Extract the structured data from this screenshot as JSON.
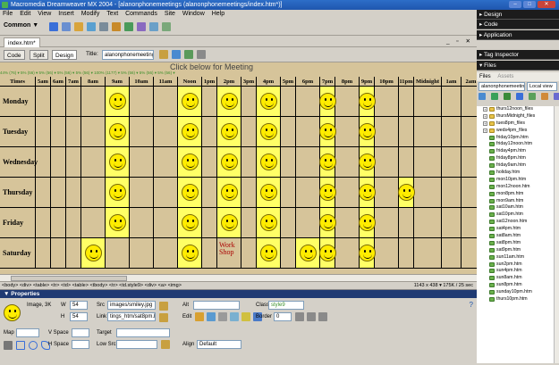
{
  "window": {
    "title": "Macromedia Dreamweaver MX 2004 - [alanonphonemeetings (alanonphonemeetings/index.htm*)]"
  },
  "menu": [
    "File",
    "Edit",
    "View",
    "Insert",
    "Modify",
    "Text",
    "Commands",
    "Site",
    "Window",
    "Help"
  ],
  "insert_bar": {
    "category": "Common ▼"
  },
  "document": {
    "tab": "index.htm*",
    "view_buttons": [
      "Code",
      "Split",
      "Design"
    ],
    "title_label": "Title:",
    "title_value": "alanonphonemeetings",
    "page_heading": "Click       below for Meeting",
    "ruler_text": "44% (76) ▾ 5% (56) ▾ 5% (56) ▾ 5% (56) ▾ 5% (56) ▾ 100% (1177) ▾ 5% (56) ▾ 5% (56) ▾ 5% (56) ▾",
    "columns": [
      "Times",
      "5am",
      "6am",
      "7am",
      "8am",
      "9am",
      "10am",
      "11am",
      "Noon",
      "1pm",
      "2pm",
      "3pm",
      "4pm",
      "5pm",
      "6pm",
      "7pm",
      "8pm",
      "9pm",
      "10pm",
      "11pm",
      "Midnight",
      "1am",
      "2am"
    ],
    "days": [
      {
        "name": "Monday",
        "slots": [
          5,
          8,
          10,
          12,
          15,
          17
        ]
      },
      {
        "name": "Tuesday",
        "slots": [
          5,
          8,
          10,
          12,
          15,
          17
        ]
      },
      {
        "name": "Wednesday",
        "slots": [
          5,
          8,
          10,
          12,
          15,
          17
        ]
      },
      {
        "name": "Thursday",
        "slots": [
          5,
          8,
          10,
          12,
          15,
          17,
          19
        ]
      },
      {
        "name": "Friday",
        "slots": [
          5,
          8,
          10,
          12,
          15,
          17
        ]
      },
      {
        "name": "Saturday",
        "slots": [
          4,
          8,
          12,
          14,
          15,
          17
        ]
      }
    ],
    "workshop_label": "Work Shop",
    "status_path": "<body> <div> <table> <tr> <td> <table> <tbody> <tr> <td.style9> <div> <a> <img>",
    "status_right": "1143 x 438 ▾ 175K / 25 sec"
  },
  "properties": {
    "header": "▼ Properties",
    "image_label": "Image, 3K",
    "w_label": "W",
    "w_value": "54",
    "h_label": "H",
    "h_value": "54",
    "src_label": "Src",
    "src_value": "images/smiley.jpg",
    "link_label": "Link",
    "link_value": "tings_htm/sat8pm.htm",
    "alt_label": "Alt",
    "class_label": "Class",
    "class_value": "style9",
    "edit_label": "Edit",
    "border_label": "Border",
    "border_value": "0",
    "align_label": "Align",
    "align_value": "Default",
    "map_label": "Map",
    "vspace_label": "V Space",
    "hspace_label": "H Space",
    "target_label": "Target",
    "lowsrc_label": "Low Src"
  },
  "panels": {
    "groups": [
      "▸ Design",
      "▸ Code",
      "▸ Application",
      "▸ Tag Inspector",
      "▾ Files"
    ],
    "files_tabs": [
      "Files",
      "Assets"
    ],
    "site": "alanonphonemeetings",
    "view": "Local view",
    "items": [
      {
        "type": "folder",
        "name": "thurs12noon_files"
      },
      {
        "type": "folder",
        "name": "thursMidnight_files"
      },
      {
        "type": "folder",
        "name": "tues8pm_files"
      },
      {
        "type": "folder",
        "name": "weds4pm_files"
      },
      {
        "type": "file",
        "name": "friday10pm.htm"
      },
      {
        "type": "file",
        "name": "friday12noon.htm"
      },
      {
        "type": "file",
        "name": "friday4pm.htm"
      },
      {
        "type": "file",
        "name": "friday8pm.htm"
      },
      {
        "type": "file",
        "name": "friday9am.htm"
      },
      {
        "type": "file",
        "name": "holiday.htm"
      },
      {
        "type": "file",
        "name": "mon10pm.htm"
      },
      {
        "type": "file",
        "name": "mon12noon.htm"
      },
      {
        "type": "file",
        "name": "mon8pm.htm"
      },
      {
        "type": "file",
        "name": "mon9am.htm"
      },
      {
        "type": "file",
        "name": "sat10am.htm"
      },
      {
        "type": "file",
        "name": "sat10pm.htm"
      },
      {
        "type": "file",
        "name": "sat12noon.htm"
      },
      {
        "type": "file",
        "name": "sat4pm.htm"
      },
      {
        "type": "file",
        "name": "sat8am.htm"
      },
      {
        "type": "file",
        "name": "sat8pm.htm"
      },
      {
        "type": "file",
        "name": "sat9pm.htm"
      },
      {
        "type": "file",
        "name": "sun11am.htm"
      },
      {
        "type": "file",
        "name": "sun2pm.htm"
      },
      {
        "type": "file",
        "name": "sun4pm.htm"
      },
      {
        "type": "file",
        "name": "sun8am.htm"
      },
      {
        "type": "file",
        "name": "sun8pm.htm"
      },
      {
        "type": "file",
        "name": "sunday10pm.htm"
      },
      {
        "type": "file",
        "name": "thurs10pm.htm"
      }
    ]
  }
}
